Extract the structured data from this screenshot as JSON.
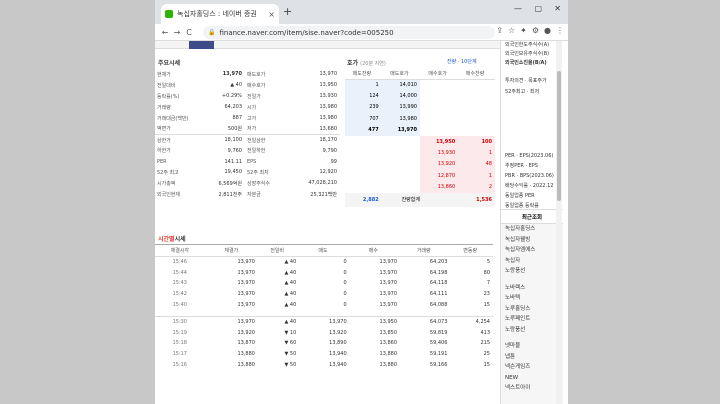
{
  "browser": {
    "tab_title": "녹십자홀딩스 : 네이버 증권",
    "tab_close": "×",
    "new_tab": "+",
    "win_min": "—",
    "win_max": "▢",
    "win_close": "✕",
    "url": "finance.naver.com/item/sise.naver?code=005250",
    "back": "←",
    "forward": "→",
    "reload": "C"
  },
  "main_quote": {
    "title": "주요시세",
    "left": [
      {
        "label": "현재가",
        "value": "13,970",
        "cls": "bold"
      },
      {
        "label": "전일대비",
        "value": "▲ 40",
        "cls": "up"
      },
      {
        "label": "등락률(%)",
        "value": "+0.29%",
        "cls": "up"
      },
      {
        "label": "거래량",
        "value": "64,203",
        "cls": ""
      },
      {
        "label": "거래대금(백만)",
        "value": "887",
        "cls": ""
      },
      {
        "label": "액면가",
        "value": "500원",
        "cls": ""
      },
      {
        "label": "상한가",
        "value": "18,100",
        "cls": ""
      },
      {
        "label": "하한가",
        "value": "9,760",
        "cls": ""
      },
      {
        "label": "PER",
        "value": "141.11",
        "cls": ""
      },
      {
        "label": "52주 최고",
        "value": "19,450",
        "cls": ""
      },
      {
        "label": "시가총액",
        "value": "6,569억원",
        "cls": ""
      },
      {
        "label": "외국인현재",
        "value": "2,811천주",
        "cls": ""
      }
    ],
    "right": [
      {
        "label": "매도호가",
        "value": "13,970"
      },
      {
        "label": "매수호가",
        "value": "13,950"
      },
      {
        "label": "전일가",
        "value": "13,930"
      },
      {
        "label": "시가",
        "value": "13,980"
      },
      {
        "label": "고가",
        "value": "13,980"
      },
      {
        "label": "저가",
        "value": "13,680"
      },
      {
        "label": "전일상한",
        "value": "18,170"
      },
      {
        "label": "전일하한",
        "value": "9,790"
      },
      {
        "label": "EPS",
        "value": "99"
      },
      {
        "label": "52주 최저",
        "value": "12,920"
      },
      {
        "label": "상장주식수",
        "value": "47,028,210"
      },
      {
        "label": "자본금",
        "value": "25,321백만"
      }
    ]
  },
  "orderbook": {
    "title": "호가",
    "subtitle": "(20분 지연)",
    "link1": "잔량",
    "link2": "10단계",
    "headers": [
      "매도잔량",
      "매도호가",
      "매수호가",
      "매수잔량"
    ],
    "asks": [
      {
        "qty": "1",
        "price": "14,010"
      },
      {
        "qty": "124",
        "price": "14,000"
      },
      {
        "qty": "239",
        "price": "13,990"
      },
      {
        "qty": "707",
        "price": "13,980"
      },
      {
        "qty": "477",
        "price": "13,970"
      }
    ],
    "bids": [
      {
        "price": "13,950",
        "qty": "100"
      },
      {
        "price": "13,930",
        "qty": "1"
      },
      {
        "price": "13,920",
        "qty": "48"
      },
      {
        "price": "12,870",
        "qty": "1"
      },
      {
        "price": "13,860",
        "qty": "2"
      }
    ],
    "total_ask": "2,882",
    "total_label": "잔량합계",
    "total_bid": "1,536"
  },
  "timeseries": {
    "title_red": "시간별",
    "title_rest": "시세",
    "headers": [
      "체결시각",
      "체결가",
      "전일비",
      "매도",
      "매수",
      "거래량",
      "변동량"
    ],
    "rows": [
      {
        "t": "15:46",
        "p": "13,970",
        "d": "▲ 40",
        "dir": "up",
        "s": "0",
        "b": "13,970",
        "v": "64,203",
        "c": "5"
      },
      {
        "t": "15:44",
        "p": "13,970",
        "d": "▲ 40",
        "dir": "up",
        "s": "0",
        "b": "13,970",
        "v": "64,198",
        "c": "80"
      },
      {
        "t": "15:43",
        "p": "13,970",
        "d": "▲ 40",
        "dir": "up",
        "s": "0",
        "b": "13,970",
        "v": "64,118",
        "c": "7"
      },
      {
        "t": "15:42",
        "p": "13,970",
        "d": "▲ 40",
        "dir": "up",
        "s": "0",
        "b": "13,970",
        "v": "64,111",
        "c": "23"
      },
      {
        "t": "15:40",
        "p": "13,970",
        "d": "▲ 40",
        "dir": "up",
        "s": "0",
        "b": "13,970",
        "v": "64,088",
        "c": "15"
      }
    ],
    "rows2": [
      {
        "t": "15:30",
        "p": "13,970",
        "d": "▲ 40",
        "dir": "up",
        "s": "13,970",
        "b": "13,950",
        "v": "64,073",
        "c": "4,254"
      },
      {
        "t": "15:19",
        "p": "13,920",
        "d": "▼ 10",
        "dir": "down",
        "s": "13,920",
        "b": "13,850",
        "v": "59,819",
        "c": "413"
      },
      {
        "t": "15:18",
        "p": "13,870",
        "d": "▼ 60",
        "dir": "down",
        "s": "13,890",
        "b": "13,860",
        "v": "59,406",
        "c": "215"
      },
      {
        "t": "15:17",
        "p": "13,880",
        "d": "▼ 50",
        "dir": "down",
        "s": "13,940",
        "b": "13,880",
        "v": "59,191",
        "c": "25"
      },
      {
        "t": "15:16",
        "p": "13,880",
        "d": "▼ 50",
        "dir": "down",
        "s": "13,940",
        "b": "13,880",
        "v": "59,166",
        "c": "15"
      }
    ]
  },
  "sidebar": {
    "top": [
      "외국인한도주식수(A)",
      "외국인보유주식수(B)",
      "외국인소진율(B/A)"
    ],
    "mid": [
      "투자의견 · 목표주가",
      "52주최고 · 최저"
    ],
    "mid2": [
      "PER · EPS(2023.06)",
      "추정PER · EPS",
      "PBR · BPS(2023.06)",
      "배당수익률 · 2022.12"
    ],
    "mid3": [
      "동일업종 PER",
      "동일업종 등락률"
    ],
    "recent_title": "최근조회",
    "recent_a": [
      "녹십자홀딩스",
      "녹십자웰빙",
      "녹십자엠에스",
      "녹십자",
      "노랑풍선"
    ],
    "recent_b": [
      "노바렉스",
      "노바텍",
      "노루홀딩스",
      "노루페인트",
      "노랑풍선"
    ],
    "recent_c": [
      "넷마블",
      "넵튠",
      "넥슨게임즈",
      "NEW",
      "넥스트아이"
    ]
  }
}
